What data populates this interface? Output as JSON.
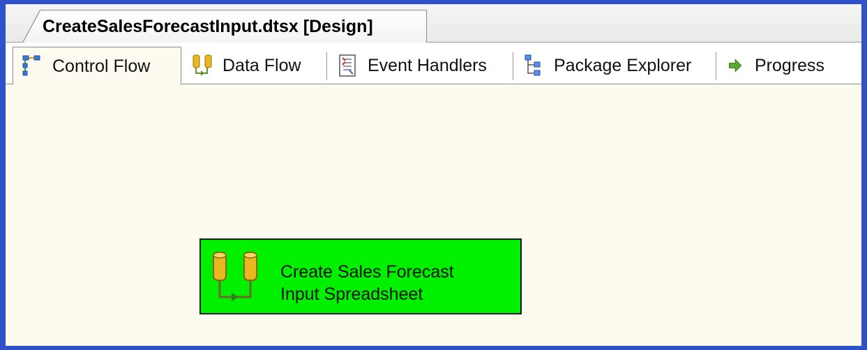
{
  "document_tab": {
    "title": "CreateSalesForecastInput.dtsx [Design]"
  },
  "designer_tabs": [
    {
      "label": "Control Flow",
      "icon": "control-flow-icon",
      "active": true
    },
    {
      "label": "Data Flow",
      "icon": "data-flow-icon",
      "active": false
    },
    {
      "label": "Event Handlers",
      "icon": "event-handlers-icon",
      "active": false
    },
    {
      "label": "Package Explorer",
      "icon": "package-explorer-icon",
      "active": false
    },
    {
      "label": "Progress",
      "icon": "progress-arrow-icon",
      "active": false
    }
  ],
  "canvas": {
    "task": {
      "line1": "Create Sales Forecast",
      "line2": "Input Spreadsheet",
      "icon": "data-flow-task-icon",
      "status_color": "#00f000"
    }
  },
  "colors": {
    "window_border": "#2f52c8",
    "canvas_background": "#fdfbee"
  }
}
